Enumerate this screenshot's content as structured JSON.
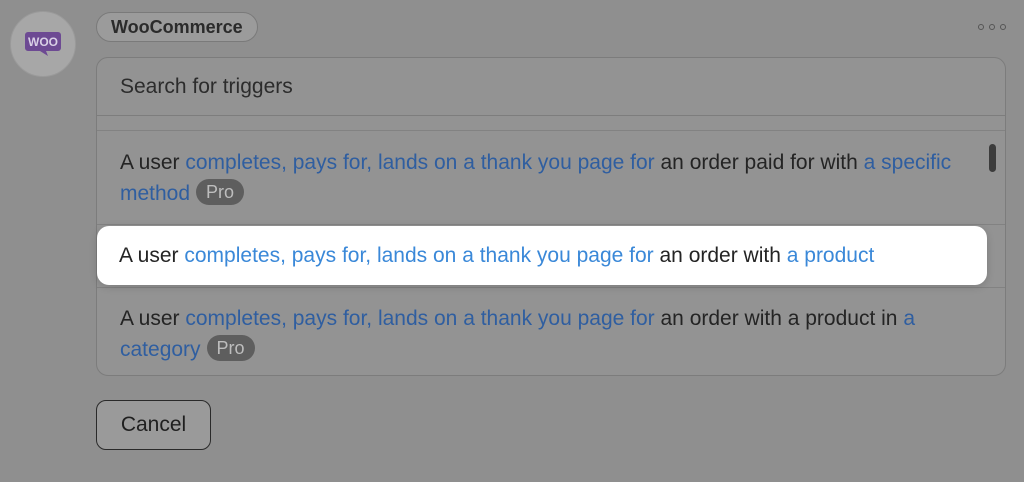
{
  "integration": {
    "logo_text": "WOO",
    "name": "WooCommerce"
  },
  "search": {
    "placeholder": "Search for triggers"
  },
  "triggers": [
    {
      "prefix": "A user ",
      "action": "completes, pays for, lands on a thank you page for",
      "middle": " an order paid for with ",
      "object": "a specific method",
      "badge": "Pro"
    },
    {
      "prefix": "A user ",
      "action": "completes, pays for, lands on a thank you page for",
      "middle": " an order with ",
      "object": "a product",
      "badge": ""
    },
    {
      "prefix": "A user ",
      "action": "completes, pays for, lands on a thank you page for",
      "middle": " an order with a product in ",
      "object": "a category",
      "badge": "Pro"
    }
  ],
  "buttons": {
    "cancel": "Cancel"
  },
  "colors": {
    "link": "#3a88d8",
    "logo": "#7f54b3"
  },
  "icons": {
    "more": "more-options-icon",
    "logo": "woocommerce-logo-icon"
  }
}
